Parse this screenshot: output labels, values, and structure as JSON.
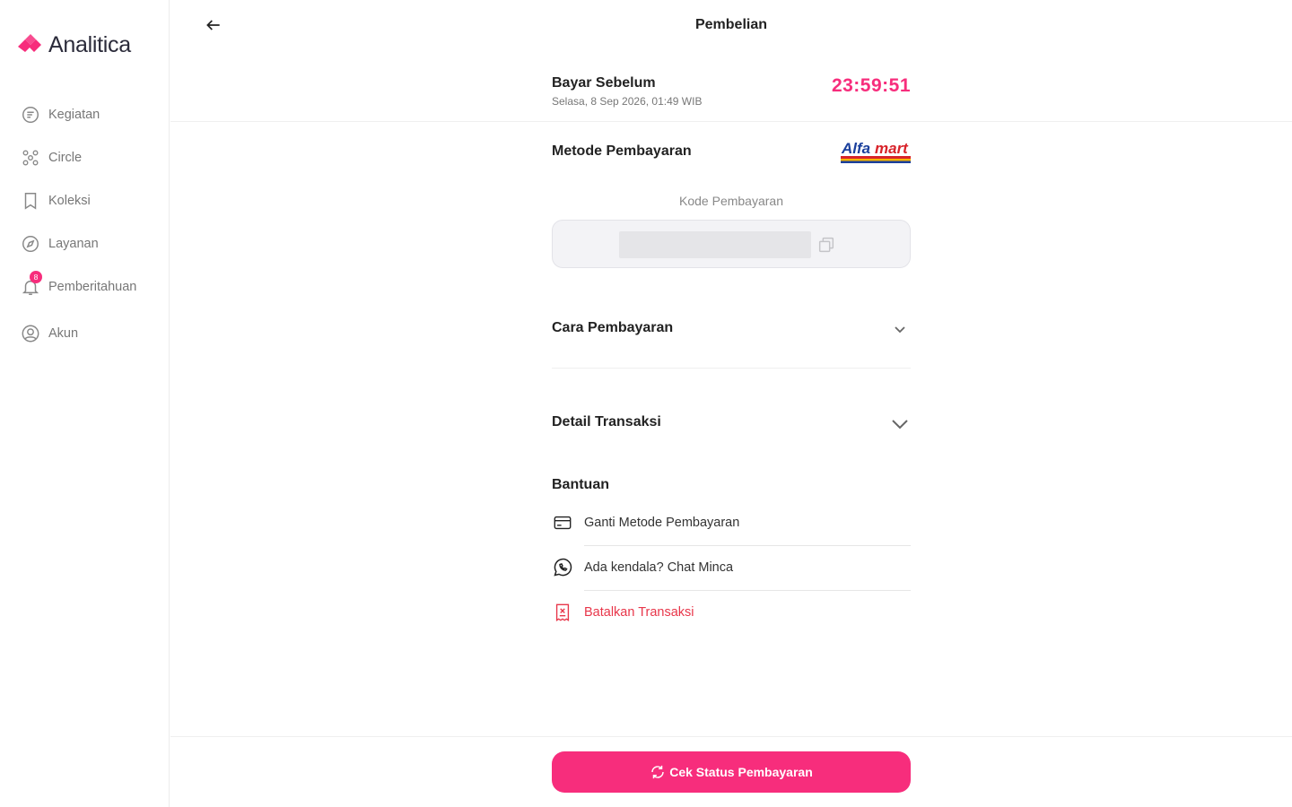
{
  "brand": {
    "name": "Analitica",
    "accent": "#f72d7c"
  },
  "sidebar": {
    "items": [
      {
        "label": "Kegiatan",
        "icon": "activity-icon"
      },
      {
        "label": "Circle",
        "icon": "circle-group-icon"
      },
      {
        "label": "Koleksi",
        "icon": "bookmark-icon"
      },
      {
        "label": "Layanan",
        "icon": "compass-icon"
      },
      {
        "label": "Pemberitahuan",
        "icon": "bell-icon",
        "badge": "8"
      },
      {
        "label": "Akun",
        "icon": "user-circle-icon"
      }
    ]
  },
  "header": {
    "title": "Pembelian",
    "back_icon": "arrow-left-icon"
  },
  "deadline": {
    "label": "Bayar Sebelum",
    "date": "Selasa, 8 Sep 2026, 01:49 WIB",
    "timer": "23:59:51"
  },
  "payment": {
    "method_label": "Metode Pembayaran",
    "method_brand": "Alfamart",
    "code_label": "Kode Pembayaran",
    "copy_icon": "copy-icon"
  },
  "accordions": [
    {
      "label": "Cara Pembayaran"
    },
    {
      "label": "Detail Transaksi"
    }
  ],
  "help": {
    "title": "Bantuan",
    "items": [
      {
        "label": "Ganti Metode Pembayaran",
        "icon": "credit-card-icon"
      },
      {
        "label": "Ada kendala? Chat Minca",
        "icon": "whatsapp-icon"
      },
      {
        "label": "Batalkan Transaksi",
        "icon": "receipt-cancel-icon",
        "color": "#e8364a"
      }
    ]
  },
  "footer": {
    "button_label": "Cek Status Pembayaran",
    "button_icon": "refresh-icon"
  }
}
